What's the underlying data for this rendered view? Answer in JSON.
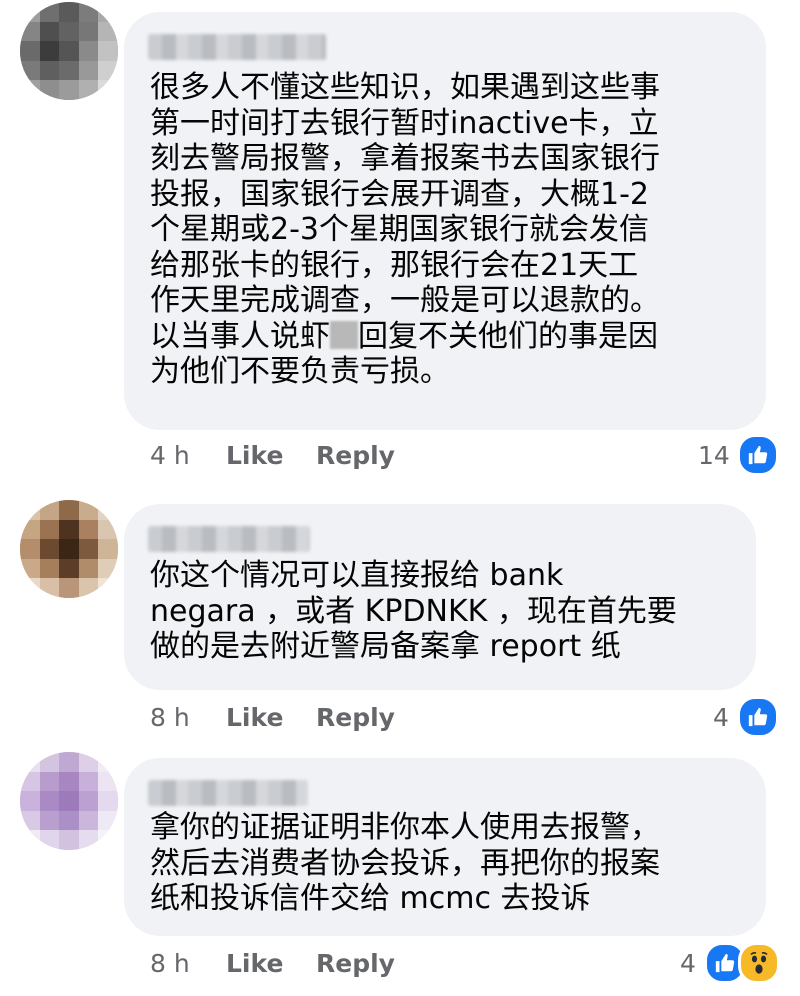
{
  "comments": [
    {
      "text_a": "很多人不懂这些知识，如果遇到这些事\n第一时间打去银行暂时inactive卡，立\n刻去警局报警，拿着报案书去国家银行\n投报，国家银行会展开调查，大概1-2\n个星期或2-3个星期国家银行就会发信\n给那张卡的银行，那银行会在21天工\n作天里完成调查，一般是可以退款的。\n以当事人说虾",
      "text_b": "回复不关他们的事是因\n为他们不要负责亏损。",
      "time": "4 h",
      "like_label": "Like",
      "reply_label": "Reply",
      "reaction_count": "14",
      "reactions": [
        "thumbs-up-icon"
      ]
    },
    {
      "text": "你这个情况可以直接报给 bank\nnegara ，或者 KPDNKK ，现在首先要\n做的是去附近警局备案拿 report 纸",
      "time": "8 h",
      "like_label": "Like",
      "reply_label": "Reply",
      "reaction_count": "4",
      "reactions": [
        "thumbs-up-icon"
      ]
    },
    {
      "text": "拿你的证据证明非你本人使用去报警，\n然后去消费者协会投诉，再把你的报案\n纸和投诉信件交给 mcmc 去投诉",
      "time": "8 h",
      "like_label": "Like",
      "reply_label": "Reply",
      "reaction_count": "4",
      "reactions": [
        "thumbs-up-icon",
        "wow-face-icon"
      ]
    }
  ],
  "colors": {
    "bubble": "#f0f2f5",
    "meta_text": "#65676b",
    "like_blue": "#1877f2",
    "wow_yellow": "#f7b928"
  }
}
